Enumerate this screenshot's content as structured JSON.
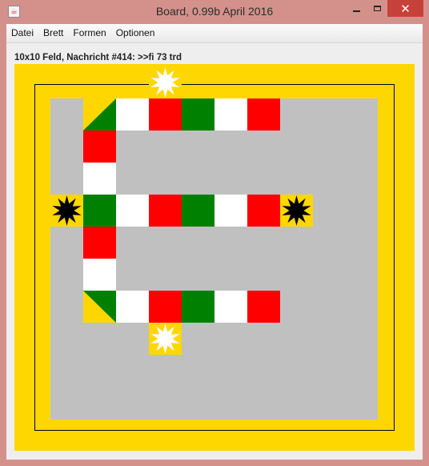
{
  "window": {
    "title": "Board, 0.99b April 2016",
    "icon": "java-cup-icon",
    "controls": {
      "minimize": "minimize-icon",
      "maximize": "maximize-icon",
      "close": "close-icon"
    }
  },
  "menu": [
    {
      "label": "Datei"
    },
    {
      "label": "Brett"
    },
    {
      "label": "Formen"
    },
    {
      "label": "Optionen"
    }
  ],
  "status_message": "10x10 Feld, Nachricht #414: >>fi 73 trd",
  "colors": {
    "board": "#ffd700",
    "field": "#c0c0c0",
    "red": "#ff0000",
    "green": "#008000",
    "white": "#ffffff",
    "yellow": "#ffd700",
    "black": "#000000"
  },
  "grid": {
    "size": "10x10",
    "cells": [
      {
        "row": 0,
        "col": 5,
        "kind": "star",
        "fill": "yellow",
        "symbol": "white-star-burst"
      },
      {
        "row": 1,
        "col": 3,
        "kind": "diag",
        "fill": "green",
        "corner": "bottom-left"
      },
      {
        "row": 1,
        "col": 4,
        "kind": "solid",
        "fill": "white"
      },
      {
        "row": 1,
        "col": 5,
        "kind": "solid",
        "fill": "red"
      },
      {
        "row": 1,
        "col": 6,
        "kind": "solid",
        "fill": "green"
      },
      {
        "row": 1,
        "col": 7,
        "kind": "solid",
        "fill": "white"
      },
      {
        "row": 1,
        "col": 8,
        "kind": "solid",
        "fill": "red"
      },
      {
        "row": 2,
        "col": 3,
        "kind": "solid",
        "fill": "red"
      },
      {
        "row": 3,
        "col": 3,
        "kind": "solid",
        "fill": "white"
      },
      {
        "row": 4,
        "col": 2,
        "kind": "star",
        "fill": "yellow",
        "symbol": "black-star-burst"
      },
      {
        "row": 4,
        "col": 3,
        "kind": "solid",
        "fill": "green"
      },
      {
        "row": 4,
        "col": 4,
        "kind": "solid",
        "fill": "white"
      },
      {
        "row": 4,
        "col": 5,
        "kind": "solid",
        "fill": "red"
      },
      {
        "row": 4,
        "col": 6,
        "kind": "solid",
        "fill": "green"
      },
      {
        "row": 4,
        "col": 7,
        "kind": "solid",
        "fill": "white"
      },
      {
        "row": 4,
        "col": 8,
        "kind": "solid",
        "fill": "red"
      },
      {
        "row": 4,
        "col": 9,
        "kind": "star",
        "fill": "yellow",
        "symbol": "black-star-burst"
      },
      {
        "row": 5,
        "col": 3,
        "kind": "solid",
        "fill": "red"
      },
      {
        "row": 6,
        "col": 3,
        "kind": "solid",
        "fill": "white"
      },
      {
        "row": 7,
        "col": 3,
        "kind": "diag",
        "fill": "green",
        "corner": "top-right"
      },
      {
        "row": 7,
        "col": 4,
        "kind": "solid",
        "fill": "white"
      },
      {
        "row": 7,
        "col": 5,
        "kind": "solid",
        "fill": "red"
      },
      {
        "row": 7,
        "col": 6,
        "kind": "solid",
        "fill": "green"
      },
      {
        "row": 7,
        "col": 7,
        "kind": "solid",
        "fill": "white"
      },
      {
        "row": 7,
        "col": 8,
        "kind": "solid",
        "fill": "red"
      },
      {
        "row": 8,
        "col": 5,
        "kind": "star",
        "fill": "yellow",
        "symbol": "white-star-burst"
      }
    ]
  }
}
